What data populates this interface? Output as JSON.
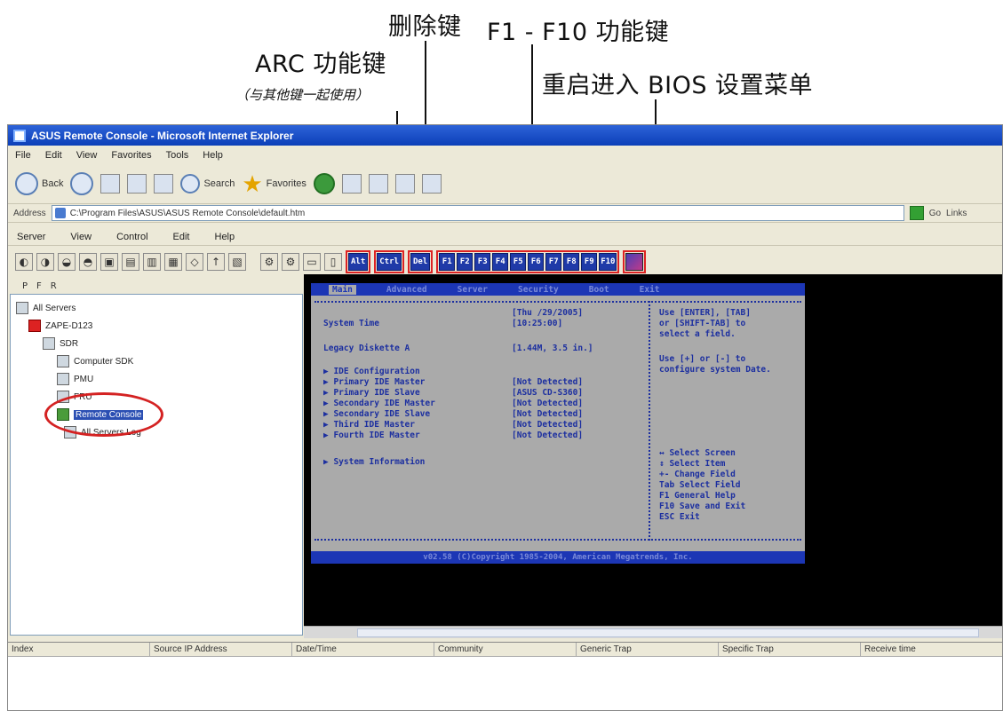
{
  "annotations": {
    "arc_keys": "ARC 功能键",
    "arc_note": "（与其他键一起使用）",
    "delete_key": "删除键",
    "f_keys": "F1 - F10 功能键",
    "restart_bios": "重启进入 BIOS 设置菜单"
  },
  "window": {
    "title": "ASUS Remote Console - Microsoft Internet Explorer"
  },
  "browser_menu": [
    "File",
    "Edit",
    "View",
    "Favorites",
    "Tools",
    "Help"
  ],
  "ie_toolbar": {
    "back": "Back",
    "search": "Search",
    "favorites": "Favorites"
  },
  "address": {
    "label": "Address",
    "value": "C:\\Program Files\\ASUS\\ASUS Remote Console\\default.htm",
    "go": "Go",
    "links": "Links"
  },
  "app_menu": [
    "Server",
    "View",
    "Control",
    "Edit",
    "Help"
  ],
  "keys": {
    "alt": "Alt",
    "ctrl": "Ctrl",
    "del": "Del",
    "fkeys": [
      "F1",
      "F2",
      "F3",
      "F4",
      "F5",
      "F6",
      "F7",
      "F8",
      "F9",
      "F10"
    ]
  },
  "tree": {
    "header": [
      "P",
      "F",
      "R"
    ],
    "root": "All Servers",
    "server": "ZAPE-D123",
    "items": [
      "SDR",
      "Computer SDK",
      "PMU",
      "FRU",
      "Remote Console",
      "All Servers Log"
    ]
  },
  "bios": {
    "menu": [
      "Main",
      "Advanced",
      "Server",
      "Security",
      "Boot",
      "Exit"
    ],
    "rows_left": [
      "System Time",
      "Legacy Diskette A",
      "▶ IDE Configuration",
      "▶ Primary IDE Master",
      "▶ Primary IDE Slave",
      "▶ Secondary IDE Master",
      "▶ Secondary IDE Slave",
      "▶ Third IDE Master",
      "▶ Fourth IDE Master",
      "▶ System Information"
    ],
    "values": [
      "[Thu  /29/2005]",
      "[10:25:00]",
      "[1.44M, 3.5 in.]",
      "[Not Detected]",
      "[ASUS CD-S360]",
      "[Not Detected]",
      "[Not Detected]",
      "[Not Detected]",
      "[Not Detected]"
    ],
    "help": [
      "Use [ENTER], [TAB]",
      "or [SHIFT-TAB] to",
      "select a field.",
      "",
      "Use [+] or [-] to",
      "configure system Date."
    ],
    "legend": [
      "↔   Select Screen",
      "↕   Select Item",
      "+-  Change Field",
      "Tab Select Field",
      "F1  General Help",
      "F10 Save and Exit",
      "ESC Exit"
    ],
    "footer": "v02.58 (C)Copyright 1985-2004, American Megatrends, Inc."
  },
  "columns": [
    "Index",
    "Source IP Address",
    "Date/Time",
    "Community",
    "Generic Trap",
    "Specific Trap",
    "Receive time"
  ]
}
